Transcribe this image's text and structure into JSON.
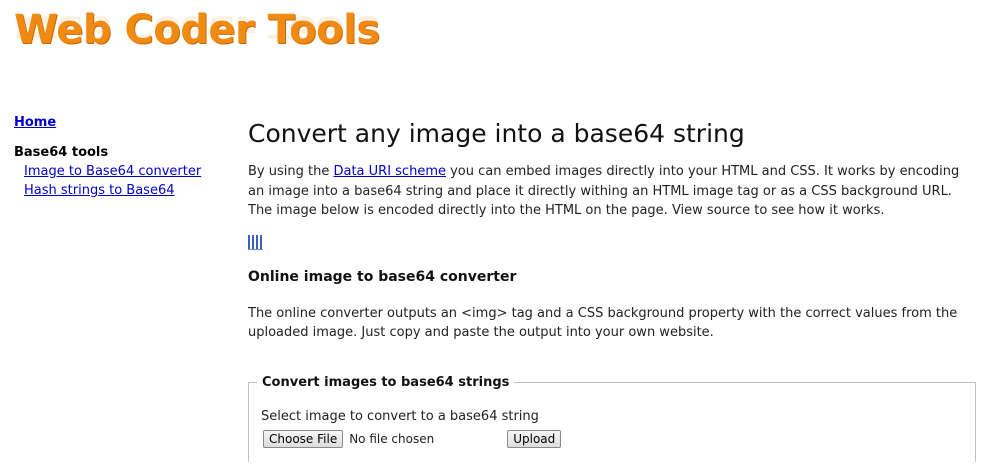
{
  "logo": {
    "text": "Web Coder Tools"
  },
  "sidebar": {
    "home_label": "Home",
    "section_heading": "Base64 tools",
    "links": [
      {
        "label": "Image to Base64 converter"
      },
      {
        "label": "Hash strings to Base64"
      }
    ]
  },
  "main": {
    "title": "Convert any image into a base64 string",
    "intro": {
      "before_link": "By using the ",
      "link_text": "Data URI scheme",
      "after_link": " you can embed images directly into your HTML and CSS. It works by encoding an image into a base64 string and place it directly withing an HTML image tag or as a CSS background URL. The image below is encoded directly into the HTML on the page. View source to see how it works."
    },
    "subheading": "Online image to base64 converter",
    "description": "The online converter outputs an <img> tag and a CSS background property with the correct values from the uploaded image. Just copy and paste the output into your own website."
  },
  "converter": {
    "legend": "Convert images to base64 strings",
    "label": "Select image to convert to a base64 string",
    "choose_file_label": "Choose File",
    "file_status": "No file chosen",
    "upload_label": "Upload"
  },
  "colors": {
    "logo": "#f08a12",
    "link": "#0000cc",
    "fieldset_border": "#c0c0c0"
  }
}
